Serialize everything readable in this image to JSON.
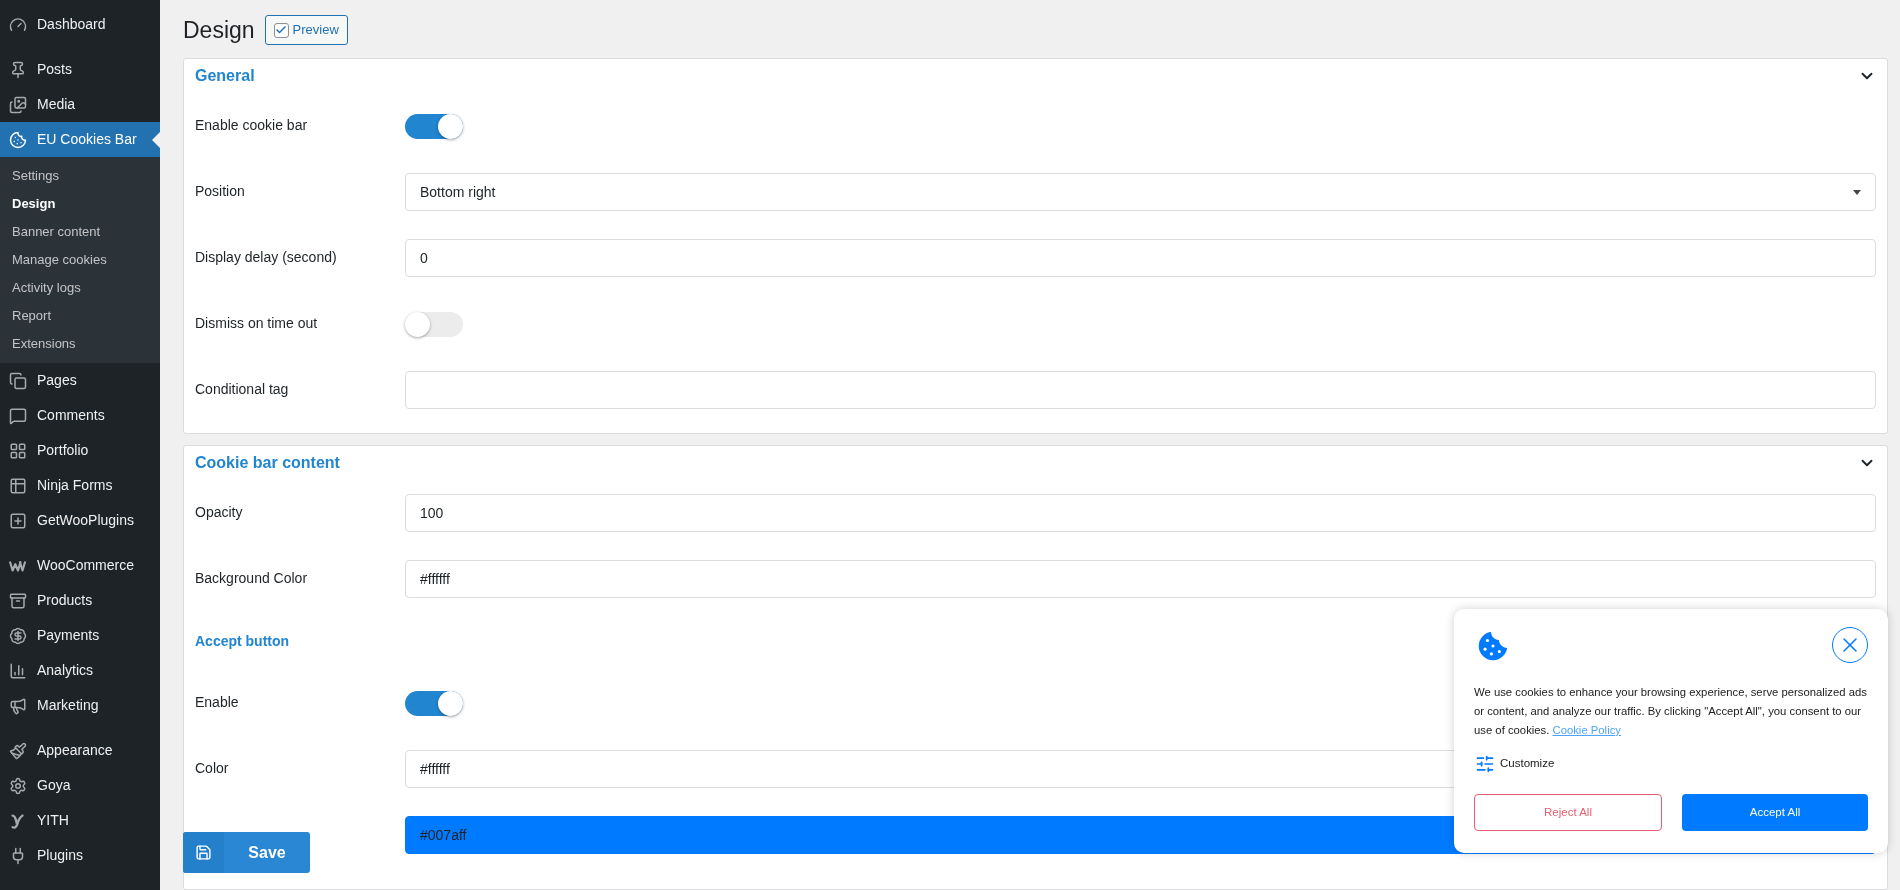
{
  "sidebar": {
    "groups": [
      [
        {
          "label": "Dashboard",
          "selected": false
        }
      ],
      [
        {
          "label": "Posts",
          "selected": false
        },
        {
          "label": "Media",
          "selected": false
        },
        {
          "label": "EU Cookies Bar",
          "selected": true,
          "children": [
            {
              "label": "Settings",
              "selected": false
            },
            {
              "label": "Design",
              "selected": true
            },
            {
              "label": "Banner content",
              "selected": false
            },
            {
              "label": "Manage cookies",
              "selected": false
            },
            {
              "label": "Activity logs",
              "selected": false
            },
            {
              "label": "Report",
              "selected": false
            },
            {
              "label": "Extensions",
              "selected": false
            }
          ]
        },
        {
          "label": "Pages",
          "selected": false
        },
        {
          "label": "Comments",
          "selected": false
        },
        {
          "label": "Portfolio",
          "selected": false
        },
        {
          "label": "Ninja Forms",
          "selected": false
        },
        {
          "label": "GetWooPlugins",
          "selected": false
        }
      ],
      [
        {
          "label": "WooCommerce",
          "selected": false
        },
        {
          "label": "Products",
          "selected": false
        },
        {
          "label": "Payments",
          "selected": false
        },
        {
          "label": "Analytics",
          "selected": false
        },
        {
          "label": "Marketing",
          "selected": false
        }
      ],
      [
        {
          "label": "Appearance",
          "selected": false
        },
        {
          "label": "Goya",
          "selected": false
        },
        {
          "label": "YITH",
          "selected": false
        },
        {
          "label": "Plugins",
          "selected": false
        }
      ]
    ]
  },
  "page": {
    "title": "Design",
    "preview": {
      "label": "Preview",
      "checked": true
    }
  },
  "sections": [
    {
      "title": "General",
      "expanded": true,
      "rows": [
        {
          "kind": "toggle",
          "label": "Enable cookie bar",
          "on": true
        },
        {
          "kind": "select",
          "label": "Position",
          "value": "Bottom right"
        },
        {
          "kind": "text",
          "label": "Display delay (second)",
          "value": "0"
        },
        {
          "kind": "toggle",
          "label": "Dismiss on time out",
          "on": false
        },
        {
          "kind": "text",
          "label": "Conditional tag"
        }
      ]
    },
    {
      "title": "Cookie bar content",
      "expanded": true,
      "rows": [
        {
          "kind": "text",
          "label": "Opacity",
          "value": "100"
        },
        {
          "kind": "color",
          "label": "Background Color",
          "value": "#ffffff",
          "color": "#ffffff"
        },
        {
          "kind": "heading",
          "label": "Accept button"
        },
        {
          "kind": "toggle",
          "label": "Enable",
          "on": true
        },
        {
          "kind": "color",
          "label": "Color",
          "value": "#ffffff",
          "color": "#ffffff"
        },
        {
          "kind": "color",
          "value": "#007aff",
          "color": "#007aff"
        }
      ]
    }
  ],
  "save_button": "Save",
  "cookie_banner": {
    "message": "We use cookies to enhance your browsing experience, serve personalized ads or content, and analyze our traffic. By clicking \"Accept All\", you consent to our use of cookies.",
    "policy_link": "Cookie Policy",
    "customize": "Customize",
    "reject": "Reject All",
    "accept": "Accept All"
  }
}
